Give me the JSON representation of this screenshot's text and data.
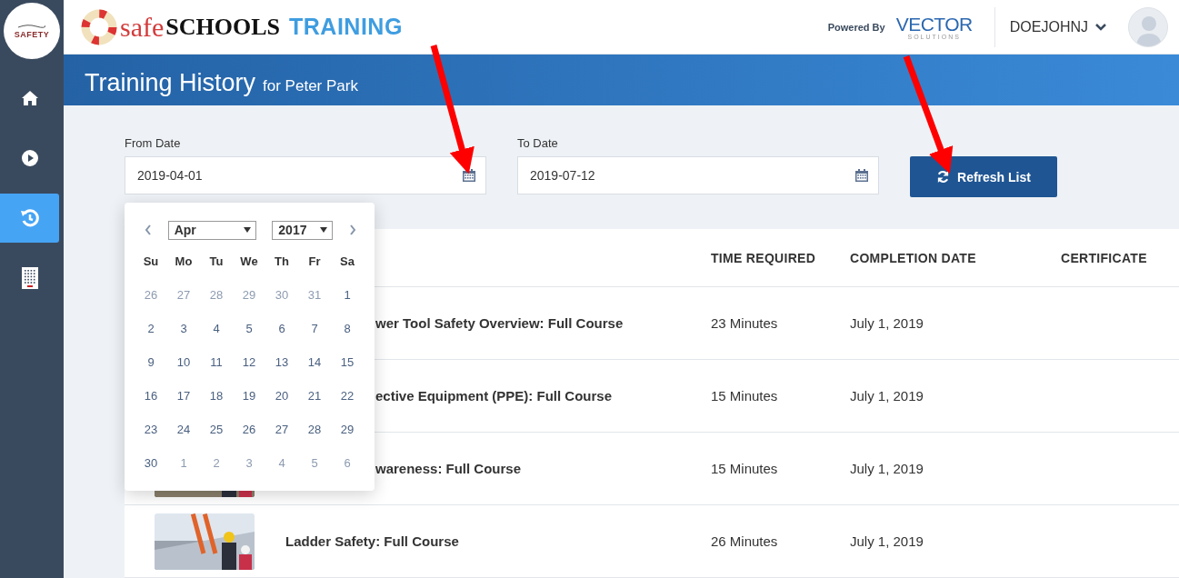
{
  "sidebar": {
    "logo_text": "SAFETY",
    "items": [
      {
        "kind": "home",
        "selected": false
      },
      {
        "kind": "play",
        "selected": false
      },
      {
        "kind": "history",
        "selected": true
      },
      {
        "kind": "building",
        "selected": false
      }
    ]
  },
  "header": {
    "brand": {
      "part1": "safe",
      "part2": "SCHOOLS",
      "part3": "TRAINING"
    },
    "powered_by": "Powered By",
    "vendor": {
      "name": "VECTOR",
      "sub": "SOLUTIONS"
    },
    "user": "DOEJOHNJ"
  },
  "banner": {
    "title": "Training History",
    "subtitle": "for Peter Park"
  },
  "filters": {
    "from": {
      "label": "From Date",
      "value": "2019-04-01"
    },
    "to": {
      "label": "To Date",
      "value": "2019-07-12"
    },
    "refresh_button": "Refresh List"
  },
  "datepicker": {
    "month": "Apr",
    "year": "2017",
    "weekdays": [
      "Su",
      "Mo",
      "Tu",
      "We",
      "Th",
      "Fr",
      "Sa"
    ],
    "weeks": [
      [
        {
          "day": "26",
          "outside": true
        },
        {
          "day": "27",
          "outside": true
        },
        {
          "day": "28",
          "outside": true
        },
        {
          "day": "29",
          "outside": true
        },
        {
          "day": "30",
          "outside": true
        },
        {
          "day": "31",
          "outside": true
        },
        {
          "day": "1",
          "outside": false
        }
      ],
      [
        {
          "day": "2",
          "outside": false
        },
        {
          "day": "3",
          "outside": false
        },
        {
          "day": "4",
          "outside": false
        },
        {
          "day": "5",
          "outside": false
        },
        {
          "day": "6",
          "outside": false
        },
        {
          "day": "7",
          "outside": false
        },
        {
          "day": "8",
          "outside": false
        }
      ],
      [
        {
          "day": "9",
          "outside": false
        },
        {
          "day": "10",
          "outside": false
        },
        {
          "day": "11",
          "outside": false
        },
        {
          "day": "12",
          "outside": false
        },
        {
          "day": "13",
          "outside": false
        },
        {
          "day": "14",
          "outside": false
        },
        {
          "day": "15",
          "outside": false
        }
      ],
      [
        {
          "day": "16",
          "outside": false
        },
        {
          "day": "17",
          "outside": false
        },
        {
          "day": "18",
          "outside": false
        },
        {
          "day": "19",
          "outside": false
        },
        {
          "day": "20",
          "outside": false
        },
        {
          "day": "21",
          "outside": false
        },
        {
          "day": "22",
          "outside": false
        }
      ],
      [
        {
          "day": "23",
          "outside": false
        },
        {
          "day": "24",
          "outside": false
        },
        {
          "day": "25",
          "outside": false
        },
        {
          "day": "26",
          "outside": false
        },
        {
          "day": "27",
          "outside": false
        },
        {
          "day": "28",
          "outside": false
        },
        {
          "day": "29",
          "outside": false
        }
      ],
      [
        {
          "day": "30",
          "outside": false
        },
        {
          "day": "1",
          "outside": true
        },
        {
          "day": "2",
          "outside": true
        },
        {
          "day": "3",
          "outside": true
        },
        {
          "day": "4",
          "outside": true
        },
        {
          "day": "5",
          "outside": true
        },
        {
          "day": "6",
          "outside": true
        }
      ]
    ]
  },
  "table": {
    "columns": [
      "TIME REQUIRED",
      "COMPLETION DATE",
      "CERTIFICATE"
    ],
    "rows": [
      {
        "title": "wer Tool Safety Overview: Full Course",
        "covered": true,
        "picture": false,
        "time": "23 Minutes",
        "completed": "July 1, 2019"
      },
      {
        "title": "ective Equipment (PPE): Full Course",
        "covered": true,
        "picture": false,
        "time": "15 Minutes",
        "completed": "July 1, 2019"
      },
      {
        "title": "wareness: Full Course",
        "covered": true,
        "picture": true,
        "time": "15 Minutes",
        "completed": "July 1, 2019"
      },
      {
        "title": "Ladder Safety: Full Course",
        "covered": false,
        "picture": true,
        "time": "26 Minutes",
        "completed": "July 1, 2019"
      }
    ]
  }
}
